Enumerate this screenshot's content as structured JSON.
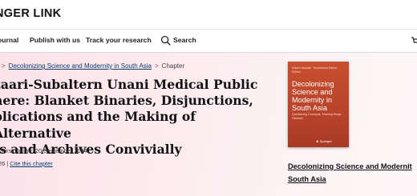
{
  "header": {
    "logo_text": "NGER LINK"
  },
  "nav": {
    "items": [
      {
        "label": "ournal"
      },
      {
        "label": "Publish with us"
      },
      {
        "label": "Track your research"
      }
    ],
    "search_label": "Search"
  },
  "breadcrumb": {
    "book_link": "Decolonizing Science and Modernity in South Asia",
    "separator": ">",
    "current": "Chapter"
  },
  "chapter": {
    "title_lines": [
      "zaari-Subaltern Unani Medical Public",
      "here: Blanket Binaries, Disjunctions,",
      "plications and the Making of Alternative",
      "ts and Archives Convivially"
    ],
    "first_online_prefix": "| First Online: ",
    "first_online_date": "20 September 2024",
    "access_count": "26",
    "meta_separator": "|",
    "cite_label": "Cite this chapter"
  },
  "book": {
    "cover_authors": "Sritara Manual · Suvanahaa Sarkar · Editors",
    "cover_title": "Decolonizing Science and Modernity in South Asia",
    "cover_subtitle": "Questioning Concepts, Tracking Rings, Histories",
    "cover_publisher": "Springer",
    "link_text": "Decolonizing Science and Modernit South Asia"
  },
  "colors": {
    "link": "#0b3a6e",
    "cover": "#c8502f",
    "content_bg": "#fbe3ea"
  }
}
